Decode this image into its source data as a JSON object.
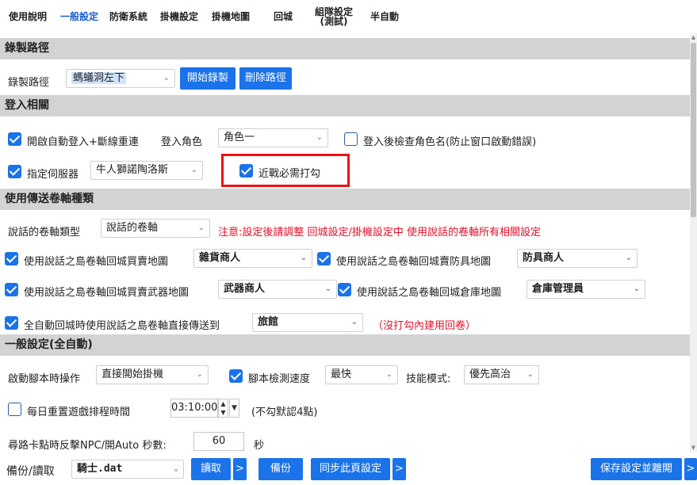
{
  "tabs": [
    "使用說明",
    "一般設定",
    "防衛系統",
    "掛機設定",
    "掛機地圖",
    "回城",
    "組隊設定\n(測試)",
    "半自動"
  ],
  "sections": {
    "record": "錄製路徑",
    "login": "登入相關",
    "scroll_type": "使用傳送卷軸種類",
    "general": "一般設定(全自動)"
  },
  "record": {
    "label": "錄製路徑",
    "path_value": "螞蟻洞左下",
    "start_button": "開始錄製",
    "delete_button": "刪除路徑"
  },
  "login": {
    "auto_login_label": "開啟自動登入+斷線重連",
    "role_label": "登入角色",
    "role_value": "角色一",
    "check_name_label": "登入後檢查角色名(防止窗口啟動錯誤)",
    "server_label": "指定伺服器",
    "server_value": "牛人獅諾陶洛斯",
    "melee_label": "近戰必需打勾"
  },
  "scroll": {
    "type_label": "說話的卷軸類型",
    "type_value": "說話的卷軸",
    "note": "注意:設定後請調整 回城設定/掛機設定中 使用說話的卷軸所有相關設定",
    "grocery_label": "使用說話之島卷軸回城買賣地圖",
    "grocery_value": "雜貨商人",
    "armor_label": "使用說話之島卷軸回城賣防具地圖",
    "armor_value": "防具商人",
    "weapon_label": "使用說話之島卷軸回城買賣武器地圖",
    "weapon_value": "武器商人",
    "storage_label": "使用說話之島卷軸回城倉庫地圖",
    "storage_value": "倉庫管理員",
    "direct_label": "全自動回城時使用說話之島卷軸直接傳送到",
    "direct_value": "旅館",
    "direct_note": "（沒打勾內建用回卷）"
  },
  "general": {
    "start_label": "啟動腳本時操作",
    "start_value": "直接開始掛機",
    "speed_label": "腳本檢測速度",
    "speed_value": "最快",
    "skill_label": "技能模式:",
    "skill_value": "優先高治",
    "reset_label": "每日重置遊戲排程時間",
    "reset_time": "03:10:00",
    "reset_note": "(不勾默認4點)",
    "npc_label": "尋路卡點時反擊NPC/開Auto 秒數:",
    "npc_value": "60",
    "npc_unit": "秒"
  },
  "bottom": {
    "backup_label": "備份/讀取",
    "file_value": "騎士.dat",
    "read_button": "讀取",
    "backup_button": "備份",
    "sync_button": "同步此頁設定",
    "save_button": "保存設定並離開",
    "more": ">"
  }
}
